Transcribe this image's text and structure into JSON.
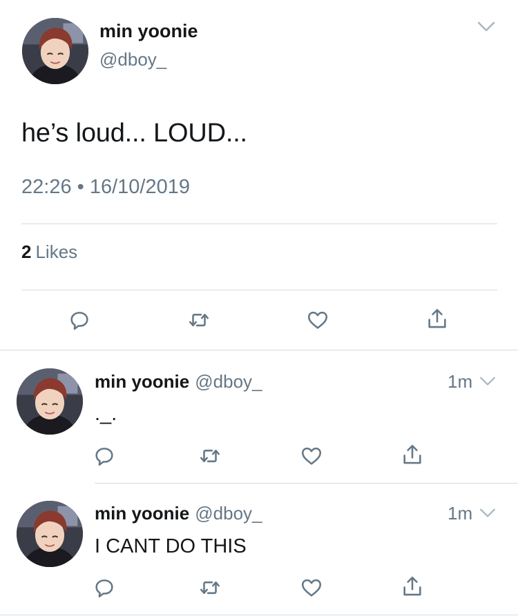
{
  "main_tweet": {
    "display_name": "min yoonie",
    "handle": "@dboy_",
    "text": "he’s loud... LOUD...",
    "timestamp": "22:26 • 16/10/2019",
    "likes_count": "2",
    "likes_label": "Likes",
    "icons": [
      "reply-icon",
      "retweet-icon",
      "like-icon",
      "share-icon",
      "chevron-down-icon"
    ]
  },
  "replies": [
    {
      "display_name": "min yoonie",
      "handle": "@dboy_",
      "time": "1m",
      "text": "._."
    },
    {
      "display_name": "min yoonie",
      "handle": "@dboy_",
      "time": "1m",
      "text": "I CANT DO THIS"
    }
  ],
  "colors": {
    "text_primary": "#14171a",
    "text_secondary": "#657786",
    "divider": "#d6dbe0",
    "icon": "#657786"
  }
}
